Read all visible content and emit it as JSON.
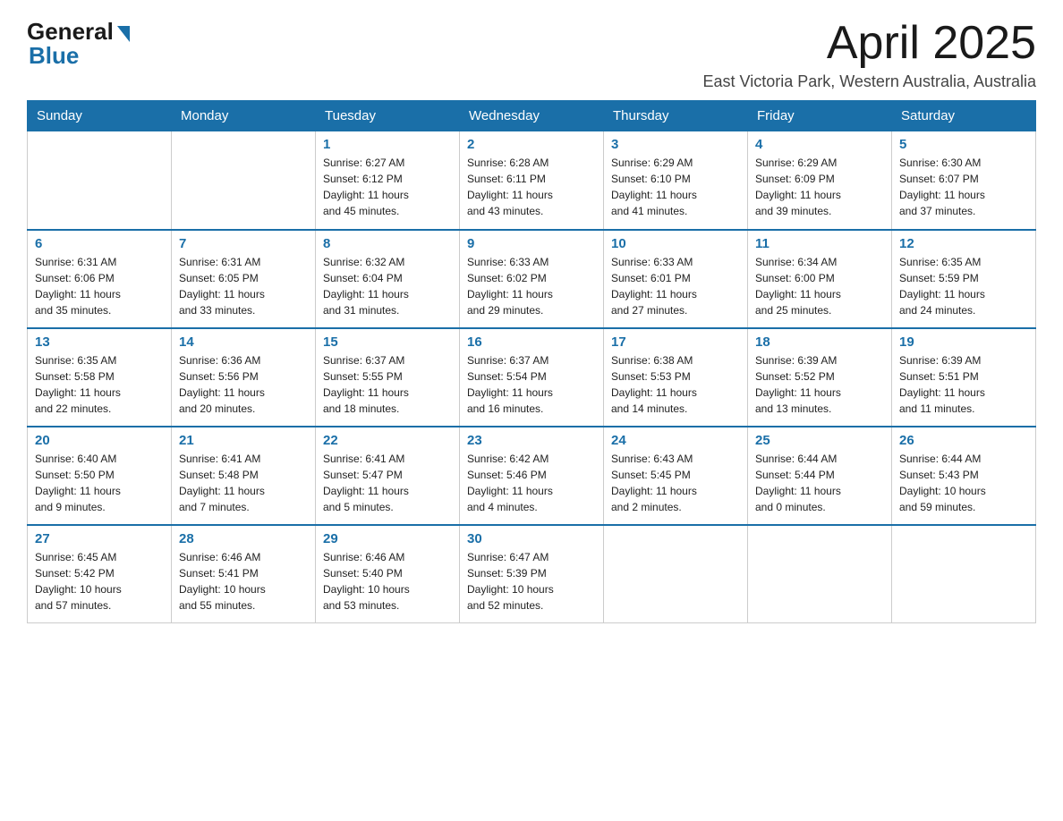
{
  "header": {
    "logo_general": "General",
    "logo_blue": "Blue",
    "month_title": "April 2025",
    "location": "East Victoria Park, Western Australia, Australia"
  },
  "days_of_week": [
    "Sunday",
    "Monday",
    "Tuesday",
    "Wednesday",
    "Thursday",
    "Friday",
    "Saturday"
  ],
  "weeks": [
    [
      {
        "day": "",
        "info": ""
      },
      {
        "day": "",
        "info": ""
      },
      {
        "day": "1",
        "info": "Sunrise: 6:27 AM\nSunset: 6:12 PM\nDaylight: 11 hours\nand 45 minutes."
      },
      {
        "day": "2",
        "info": "Sunrise: 6:28 AM\nSunset: 6:11 PM\nDaylight: 11 hours\nand 43 minutes."
      },
      {
        "day": "3",
        "info": "Sunrise: 6:29 AM\nSunset: 6:10 PM\nDaylight: 11 hours\nand 41 minutes."
      },
      {
        "day": "4",
        "info": "Sunrise: 6:29 AM\nSunset: 6:09 PM\nDaylight: 11 hours\nand 39 minutes."
      },
      {
        "day": "5",
        "info": "Sunrise: 6:30 AM\nSunset: 6:07 PM\nDaylight: 11 hours\nand 37 minutes."
      }
    ],
    [
      {
        "day": "6",
        "info": "Sunrise: 6:31 AM\nSunset: 6:06 PM\nDaylight: 11 hours\nand 35 minutes."
      },
      {
        "day": "7",
        "info": "Sunrise: 6:31 AM\nSunset: 6:05 PM\nDaylight: 11 hours\nand 33 minutes."
      },
      {
        "day": "8",
        "info": "Sunrise: 6:32 AM\nSunset: 6:04 PM\nDaylight: 11 hours\nand 31 minutes."
      },
      {
        "day": "9",
        "info": "Sunrise: 6:33 AM\nSunset: 6:02 PM\nDaylight: 11 hours\nand 29 minutes."
      },
      {
        "day": "10",
        "info": "Sunrise: 6:33 AM\nSunset: 6:01 PM\nDaylight: 11 hours\nand 27 minutes."
      },
      {
        "day": "11",
        "info": "Sunrise: 6:34 AM\nSunset: 6:00 PM\nDaylight: 11 hours\nand 25 minutes."
      },
      {
        "day": "12",
        "info": "Sunrise: 6:35 AM\nSunset: 5:59 PM\nDaylight: 11 hours\nand 24 minutes."
      }
    ],
    [
      {
        "day": "13",
        "info": "Sunrise: 6:35 AM\nSunset: 5:58 PM\nDaylight: 11 hours\nand 22 minutes."
      },
      {
        "day": "14",
        "info": "Sunrise: 6:36 AM\nSunset: 5:56 PM\nDaylight: 11 hours\nand 20 minutes."
      },
      {
        "day": "15",
        "info": "Sunrise: 6:37 AM\nSunset: 5:55 PM\nDaylight: 11 hours\nand 18 minutes."
      },
      {
        "day": "16",
        "info": "Sunrise: 6:37 AM\nSunset: 5:54 PM\nDaylight: 11 hours\nand 16 minutes."
      },
      {
        "day": "17",
        "info": "Sunrise: 6:38 AM\nSunset: 5:53 PM\nDaylight: 11 hours\nand 14 minutes."
      },
      {
        "day": "18",
        "info": "Sunrise: 6:39 AM\nSunset: 5:52 PM\nDaylight: 11 hours\nand 13 minutes."
      },
      {
        "day": "19",
        "info": "Sunrise: 6:39 AM\nSunset: 5:51 PM\nDaylight: 11 hours\nand 11 minutes."
      }
    ],
    [
      {
        "day": "20",
        "info": "Sunrise: 6:40 AM\nSunset: 5:50 PM\nDaylight: 11 hours\nand 9 minutes."
      },
      {
        "day": "21",
        "info": "Sunrise: 6:41 AM\nSunset: 5:48 PM\nDaylight: 11 hours\nand 7 minutes."
      },
      {
        "day": "22",
        "info": "Sunrise: 6:41 AM\nSunset: 5:47 PM\nDaylight: 11 hours\nand 5 minutes."
      },
      {
        "day": "23",
        "info": "Sunrise: 6:42 AM\nSunset: 5:46 PM\nDaylight: 11 hours\nand 4 minutes."
      },
      {
        "day": "24",
        "info": "Sunrise: 6:43 AM\nSunset: 5:45 PM\nDaylight: 11 hours\nand 2 minutes."
      },
      {
        "day": "25",
        "info": "Sunrise: 6:44 AM\nSunset: 5:44 PM\nDaylight: 11 hours\nand 0 minutes."
      },
      {
        "day": "26",
        "info": "Sunrise: 6:44 AM\nSunset: 5:43 PM\nDaylight: 10 hours\nand 59 minutes."
      }
    ],
    [
      {
        "day": "27",
        "info": "Sunrise: 6:45 AM\nSunset: 5:42 PM\nDaylight: 10 hours\nand 57 minutes."
      },
      {
        "day": "28",
        "info": "Sunrise: 6:46 AM\nSunset: 5:41 PM\nDaylight: 10 hours\nand 55 minutes."
      },
      {
        "day": "29",
        "info": "Sunrise: 6:46 AM\nSunset: 5:40 PM\nDaylight: 10 hours\nand 53 minutes."
      },
      {
        "day": "30",
        "info": "Sunrise: 6:47 AM\nSunset: 5:39 PM\nDaylight: 10 hours\nand 52 minutes."
      },
      {
        "day": "",
        "info": ""
      },
      {
        "day": "",
        "info": ""
      },
      {
        "day": "",
        "info": ""
      }
    ]
  ]
}
